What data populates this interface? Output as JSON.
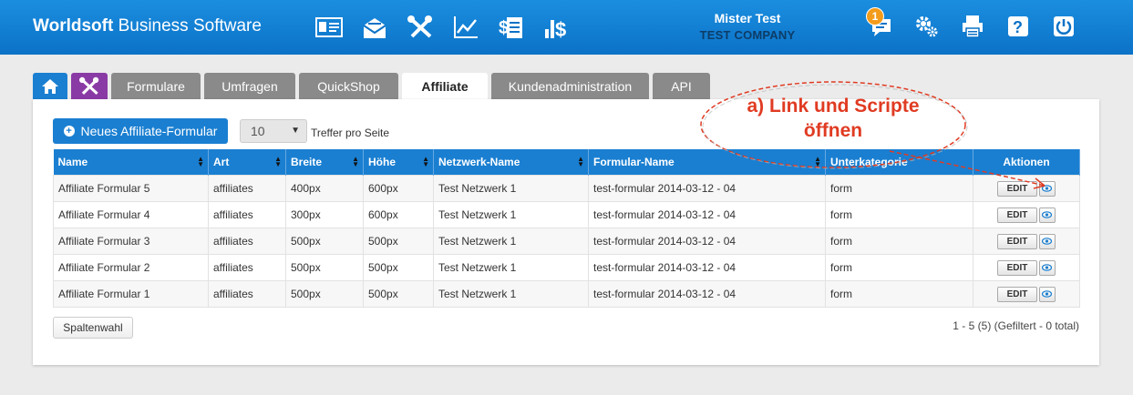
{
  "header": {
    "brand_bold": "Worldsoft",
    "brand_rest": " Business Software",
    "user_name": "Mister Test",
    "company": "TEST COMPANY",
    "notification_count": "1",
    "nav_icons": [
      "contact-card-icon",
      "mail-icon",
      "tools-icon",
      "chart-icon",
      "invoice-icon",
      "revenue-icon"
    ],
    "right_icons": [
      "messages-icon",
      "settings-icon",
      "print-icon",
      "help-icon",
      "power-icon"
    ]
  },
  "tabs": [
    {
      "label": "Formulare"
    },
    {
      "label": "Umfragen"
    },
    {
      "label": "QuickShop"
    },
    {
      "label": "Affiliate",
      "active": true
    },
    {
      "label": "Kundenadministration"
    },
    {
      "label": "API"
    }
  ],
  "toolbar": {
    "new_button": "Neues Affiliate-Formular",
    "page_size": "10",
    "per_page_label": "Treffer pro Seite"
  },
  "table": {
    "columns": [
      "Name",
      "Art",
      "Breite",
      "Höhe",
      "Netzwerk-Name",
      "Formular-Name",
      "Unterkategorie",
      "Aktionen"
    ],
    "edit_label": "EDIT",
    "rows": [
      [
        "Affiliate Formular 5",
        "affiliates",
        "400px",
        "600px",
        "Test Netzwerk 1",
        "test-formular 2014-03-12 - 04",
        "form"
      ],
      [
        "Affiliate Formular 4",
        "affiliates",
        "300px",
        "600px",
        "Test Netzwerk 1",
        "test-formular 2014-03-12 - 04",
        "form"
      ],
      [
        "Affiliate Formular 3",
        "affiliates",
        "500px",
        "500px",
        "Test Netzwerk 1",
        "test-formular 2014-03-12 - 04",
        "form"
      ],
      [
        "Affiliate Formular 2",
        "affiliates",
        "500px",
        "500px",
        "Test Netzwerk 1",
        "test-formular 2014-03-12 - 04",
        "form"
      ],
      [
        "Affiliate Formular 1",
        "affiliates",
        "500px",
        "500px",
        "Test Netzwerk 1",
        "test-formular 2014-03-12 - 04",
        "form"
      ]
    ]
  },
  "footer": {
    "column_button": "Spaltenwahl",
    "pager_info": "1 - 5 (5) (Gefiltert - 0 total)"
  },
  "annotation": {
    "line1": "a) Link und Scripte",
    "line2": "öffnen",
    "color": "#e03b22"
  },
  "colors": {
    "header_blue": "#0b72c7",
    "accent_blue": "#1a7fd1",
    "tools_purple": "#8a3aa5",
    "tab_gray": "#8a8a8a",
    "badge_orange": "#f39c1b"
  }
}
